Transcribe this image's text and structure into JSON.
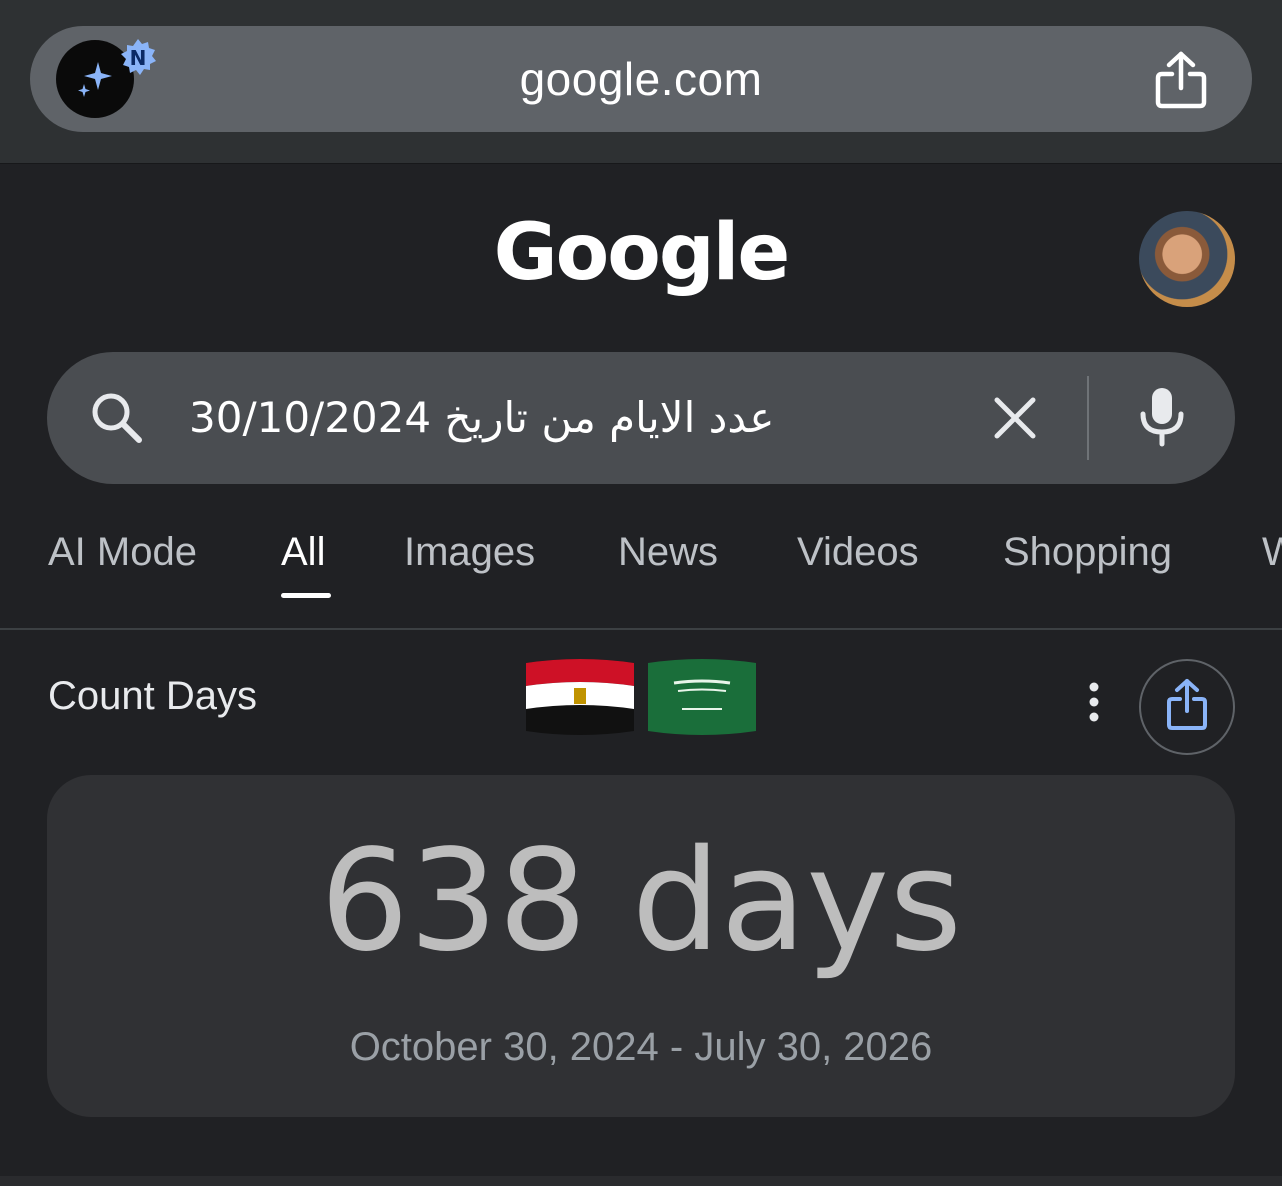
{
  "browser": {
    "url": "google.com",
    "ai_badge_letter": "N",
    "ai_badge_color": "#8ab4f8",
    "share_icon": "share-icon"
  },
  "header": {
    "logo": "Google",
    "avatar": "account-avatar"
  },
  "search": {
    "query": "عدد الايام من تاريخ 30/10/2024",
    "search_icon": "search-icon",
    "clear_icon": "close-icon",
    "mic_icon": "mic-icon"
  },
  "tabs": [
    {
      "label": "AI Mode",
      "active": false
    },
    {
      "label": "All",
      "active": true
    },
    {
      "label": "Images",
      "active": false
    },
    {
      "label": "News",
      "active": false
    },
    {
      "label": "Videos",
      "active": false
    },
    {
      "label": "Shopping",
      "active": false
    },
    {
      "label": "W",
      "active": false
    }
  ],
  "result": {
    "title": "Count Days",
    "flags": [
      "egypt-flag",
      "saudi-arabia-flag"
    ],
    "answer": "638 days",
    "range": "October 30, 2024 - July 30, 2026"
  },
  "colors": {
    "page_bg": "#202124",
    "search_bg": "#4a4d51",
    "card_bg": "#303134",
    "share_accent": "#8ab4f8"
  }
}
